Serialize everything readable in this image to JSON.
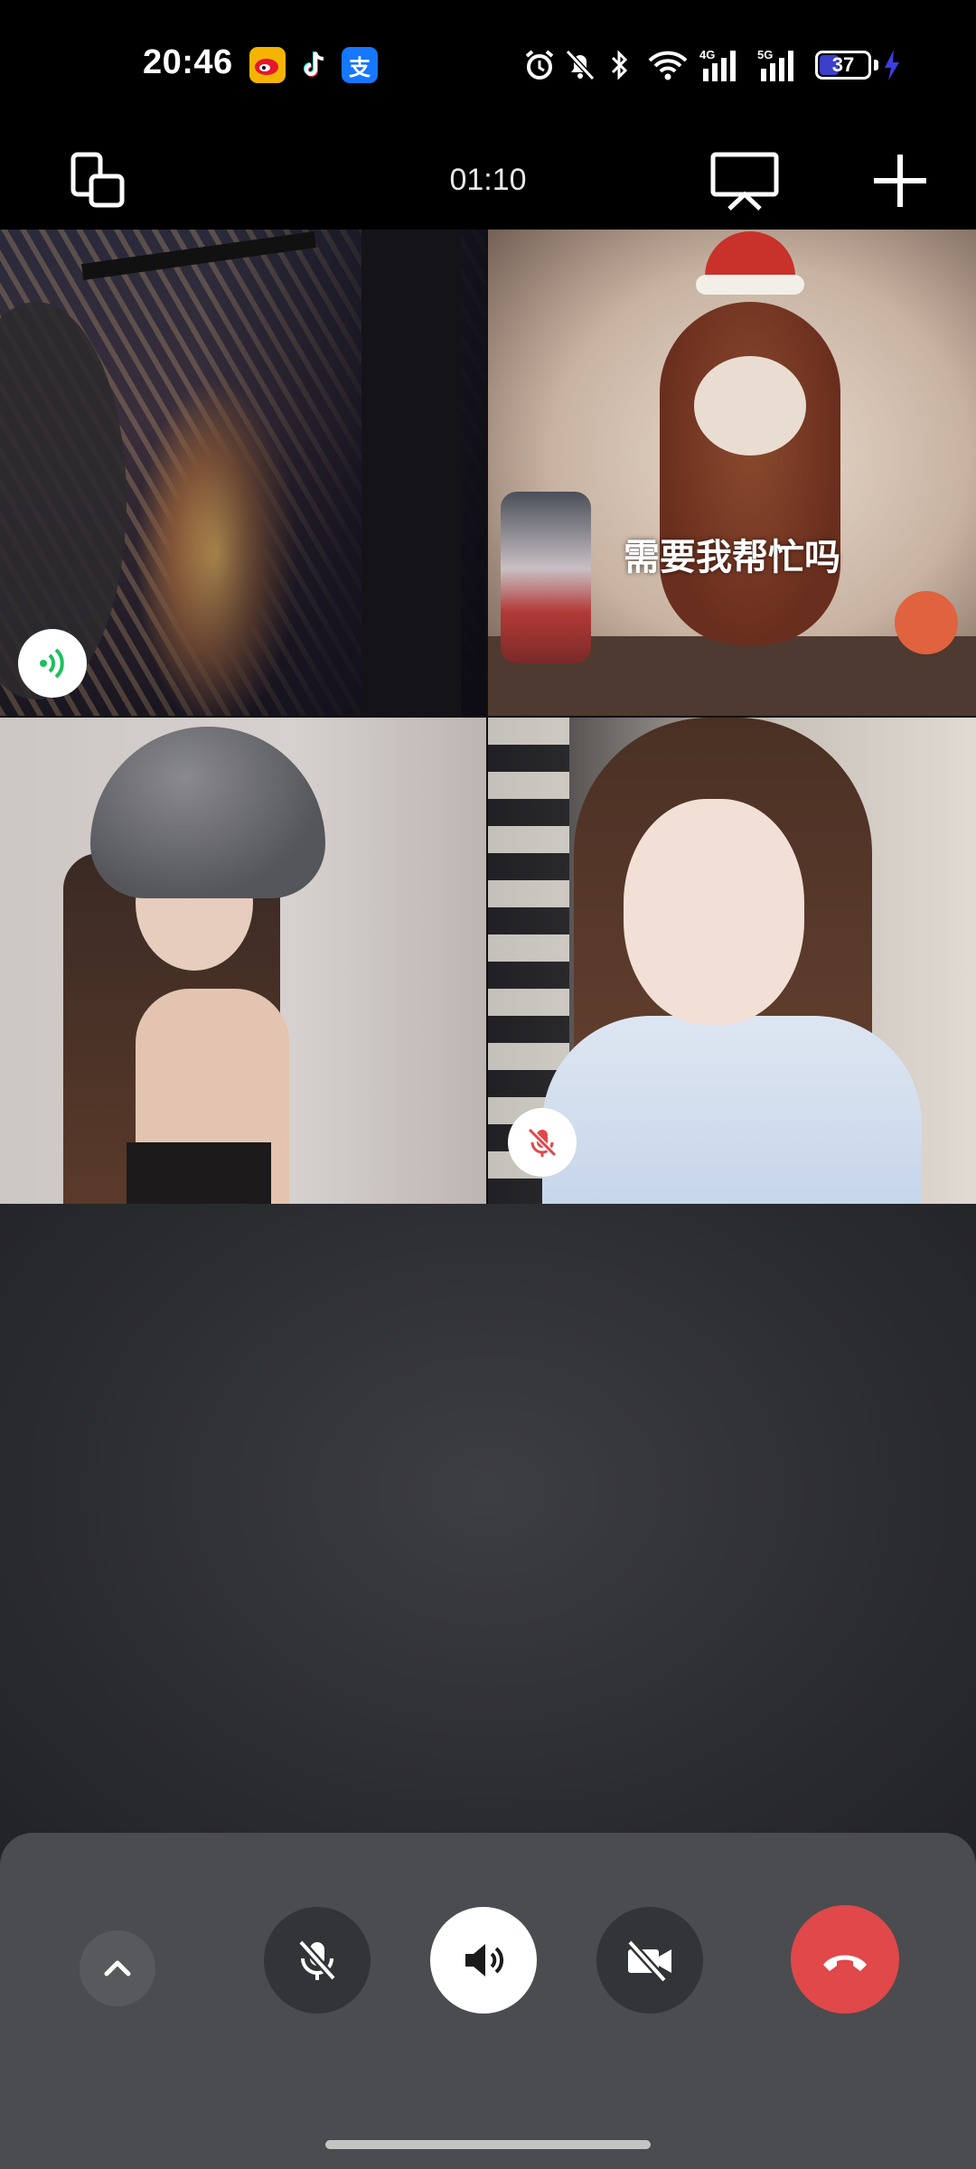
{
  "status_bar": {
    "time": "20:46",
    "apps": [
      "weibo-icon",
      "tiktok-icon",
      "alipay-icon"
    ],
    "alipay_glyph": "支",
    "network_4g": "4G",
    "network_5g": "5G",
    "battery": "37",
    "icons": [
      "alarm-icon",
      "mute-bell-icon",
      "bluetooth-icon",
      "wifi-icon",
      "signal-4g-icon",
      "signal-5g-icon",
      "battery-icon",
      "charging-icon"
    ]
  },
  "call_header": {
    "timer": "01:10",
    "icons": [
      "switch-window-icon",
      "screen-share-icon",
      "add-participant-icon"
    ]
  },
  "participants": [
    {
      "id": "p1",
      "status": "speaking",
      "status_icon": "speaking-icon"
    },
    {
      "id": "p2",
      "caption": "需要我帮忙吗"
    },
    {
      "id": "p3"
    },
    {
      "id": "p4",
      "status": "muted",
      "status_icon": "mic-off-icon"
    }
  ],
  "controls": [
    {
      "name": "expand",
      "icon": "chevron-up-icon"
    },
    {
      "name": "microphone",
      "icon": "mic-off-icon",
      "state": "off"
    },
    {
      "name": "speaker",
      "icon": "speaker-icon",
      "state": "on"
    },
    {
      "name": "camera",
      "icon": "camera-off-icon",
      "state": "off"
    },
    {
      "name": "hang-up",
      "icon": "phone-hangup-icon"
    }
  ],
  "colors": {
    "hangup": "#e0484a",
    "speaker_active": "#ffffff",
    "speaking_green": "#1fbf5f",
    "muted_red": "#e0484a"
  }
}
